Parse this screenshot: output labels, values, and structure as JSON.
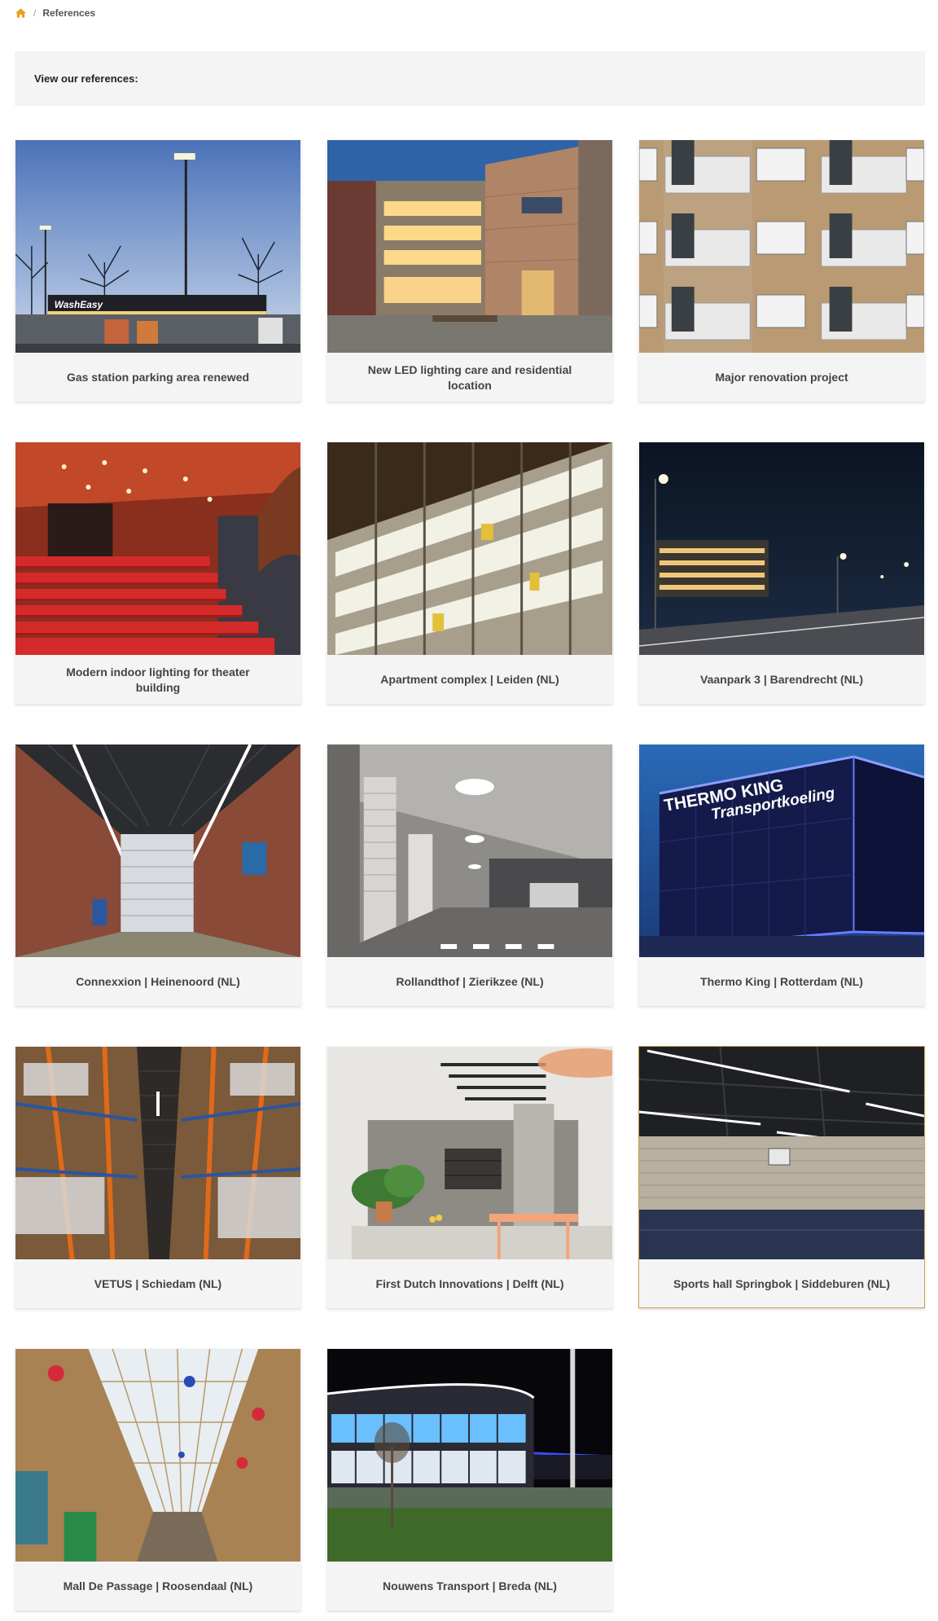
{
  "breadcrumb": {
    "home_icon": "home-icon",
    "current": "References"
  },
  "intro": {
    "text": "View our references:"
  },
  "colors": {
    "accent": "#e8a01c",
    "selected_border": "#c9a44a",
    "card_bg": "#f4f4f4"
  },
  "references": [
    {
      "caption": "Gas station parking area renewed",
      "image": "gas-station-night"
    },
    {
      "caption": "New LED lighting care and residential location",
      "image": "residential-building-dusk"
    },
    {
      "caption": "Major renovation project",
      "image": "apartment-balconies"
    },
    {
      "caption": "Modern indoor lighting for theater building",
      "image": "theater-red-seats"
    },
    {
      "caption": "Apartment complex | Leiden (NL)",
      "image": "apartment-facade-night"
    },
    {
      "caption": "Vaanpark 3 | Barendrecht (NL)",
      "image": "street-lights-night"
    },
    {
      "caption": "Connexxion | Heinenoord (NL)",
      "image": "garage-linear-lights"
    },
    {
      "caption": "Rollandthof | Zierikzee (NL)",
      "image": "parking-garage-ceiling-light"
    },
    {
      "caption": "Thermo King | Rotterdam (NL)",
      "image": "thermo-king-building-blue"
    },
    {
      "caption": "VETUS | Schiedam (NL)",
      "image": "warehouse-racks"
    },
    {
      "caption": "First Dutch Innovations | Delft (NL)",
      "image": "office-pantry"
    },
    {
      "caption": "Sports hall Springbok | Siddeburen (NL)",
      "image": "sports-hall-lights"
    },
    {
      "caption": "Mall De Passage | Roosendaal (NL)",
      "image": "shopping-arcade"
    },
    {
      "caption": "Nouwens Transport | Breda (NL)",
      "image": "curved-office-building-night"
    }
  ],
  "image_text": {
    "wash_sign": "WashEasy",
    "thermo_line1": "THERMO KING",
    "thermo_line2": "Transportkoeling"
  }
}
